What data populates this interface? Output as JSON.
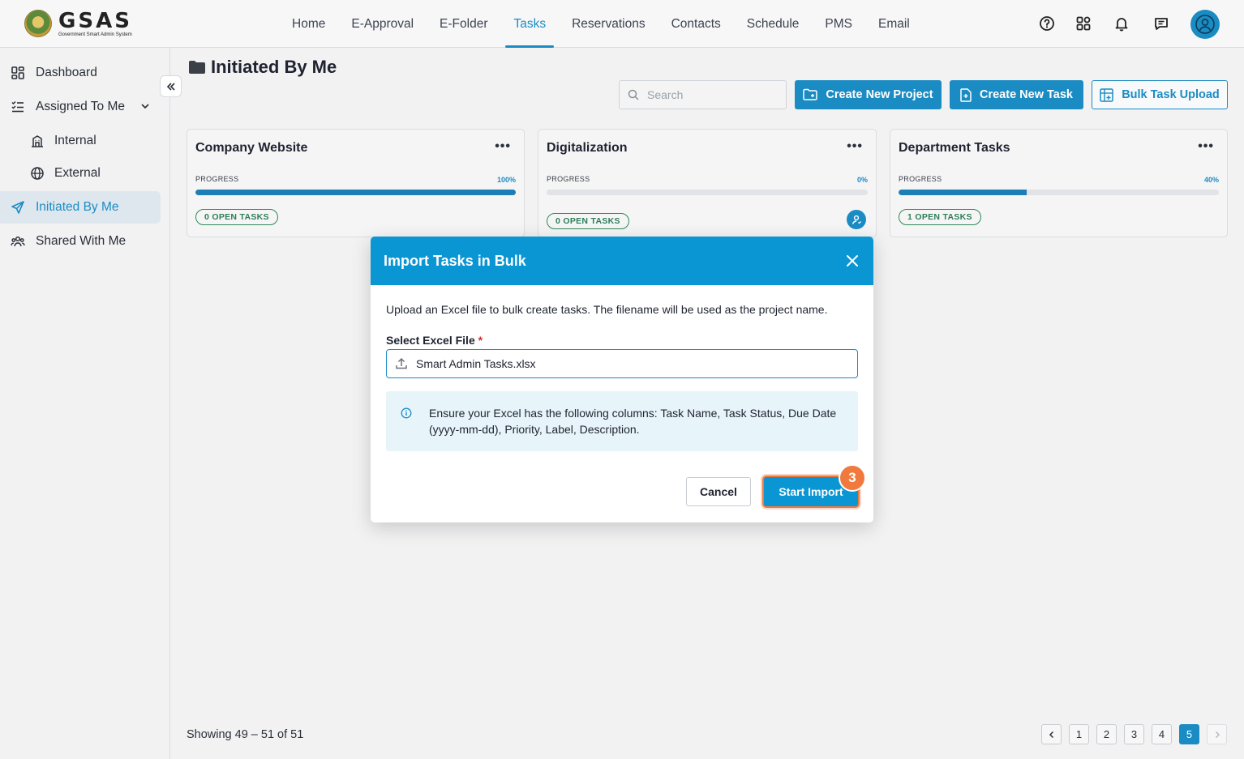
{
  "app": {
    "logo_title": "GSAS",
    "logo_subtitle": "Government Smart Admin System"
  },
  "nav": {
    "items": [
      "Home",
      "E-Approval",
      "E-Folder",
      "Tasks",
      "Reservations",
      "Contacts",
      "Schedule",
      "PMS",
      "Email"
    ],
    "active": "Tasks"
  },
  "sidebar": {
    "items": [
      {
        "label": "Dashboard",
        "icon": "dashboard-icon"
      },
      {
        "label": "Assigned To Me",
        "icon": "list-check-icon"
      },
      {
        "label": "Internal",
        "icon": "building-icon"
      },
      {
        "label": "External",
        "icon": "globe-icon"
      },
      {
        "label": "Initiated By Me",
        "icon": "send-icon"
      },
      {
        "label": "Shared With Me",
        "icon": "users-icon"
      }
    ],
    "active": "Initiated By Me"
  },
  "page": {
    "title": "Initiated By Me",
    "search_placeholder": "Search",
    "create_project_label": "Create New Project",
    "create_task_label": "Create New Task",
    "bulk_upload_label": "Bulk Task Upload"
  },
  "projects": [
    {
      "name": "Company Website",
      "progress_label": "PROGRESS",
      "progress_text": "100%",
      "progress": 1.0,
      "open_tasks": "0 OPEN TASKS"
    },
    {
      "name": "Digitalization",
      "progress_label": "PROGRESS",
      "progress_text": "0%",
      "progress": 0.0,
      "open_tasks": "0 OPEN TASKS"
    },
    {
      "name": "Department Tasks",
      "progress_label": "PROGRESS",
      "progress_text": "40%",
      "progress": 0.4,
      "open_tasks": "1 OPEN TASKS"
    }
  ],
  "pagination": {
    "showing": "Showing 49 – 51 of 51",
    "pages": [
      "1",
      "2",
      "3",
      "4",
      "5"
    ],
    "current": "5"
  },
  "modal": {
    "title": "Import Tasks in Bulk",
    "description": "Upload an Excel file to bulk create tasks. The filename will be used as the project name.",
    "field_label": "Select Excel File",
    "required_mark": "*",
    "file_name": "Smart Admin Tasks.xlsx",
    "info": "Ensure your Excel has the following columns: Task Name, Task Status, Due Date (yyyy-mm-dd), Priority, Label, Description.",
    "cancel_label": "Cancel",
    "import_label": "Start Import",
    "step_number": "3"
  },
  "colors": {
    "accent": "#1b8cc3",
    "modal_header": "#0a96d3",
    "highlight": "#f07a3e",
    "badge_green": "#2e8b57"
  }
}
